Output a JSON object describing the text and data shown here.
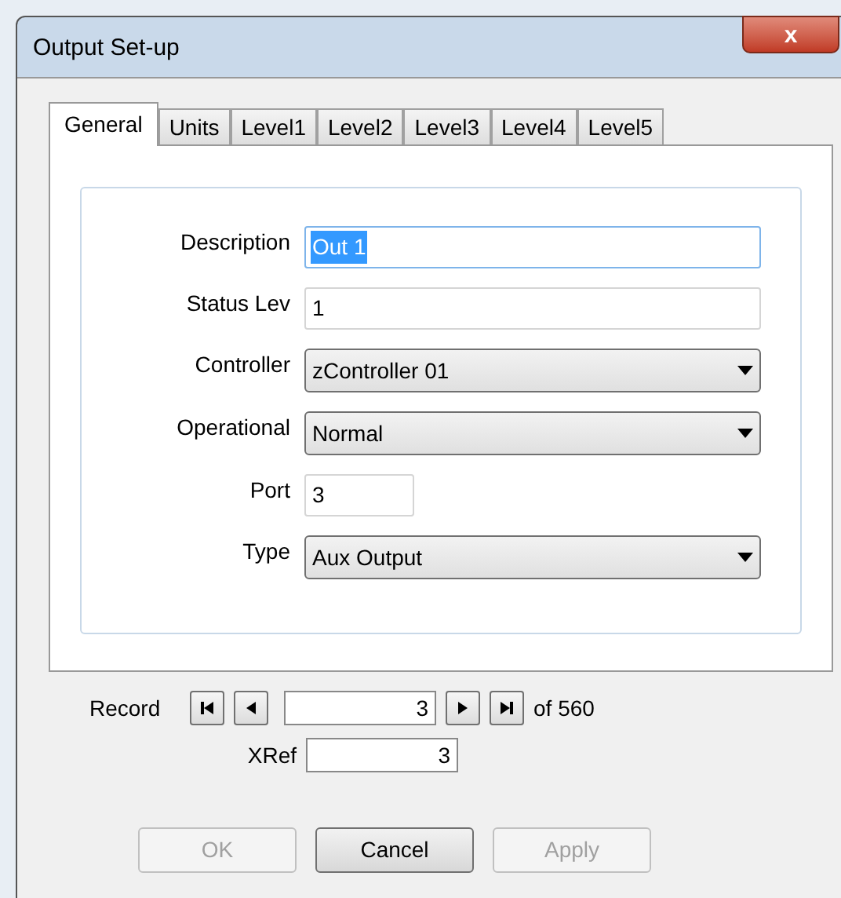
{
  "window": {
    "title": "Output Set-up",
    "close": "x"
  },
  "tabs": [
    {
      "label": "General",
      "selected": true
    },
    {
      "label": "Units",
      "selected": false
    },
    {
      "label": "Level1",
      "selected": false
    },
    {
      "label": "Level2",
      "selected": false
    },
    {
      "label": "Level3",
      "selected": false
    },
    {
      "label": "Level4",
      "selected": false
    },
    {
      "label": "Level5",
      "selected": false
    }
  ],
  "fields": [
    {
      "label": "Description",
      "kind": "text",
      "value": "Out 1",
      "focused": true
    },
    {
      "label": "Status Lev",
      "kind": "text",
      "value": "1",
      "focused": false
    },
    {
      "label": "Controller",
      "kind": "dropdown",
      "value": "zController 01",
      "focused": false
    },
    {
      "label": "Operational",
      "kind": "dropdown",
      "value": "Normal",
      "focused": false
    },
    {
      "label": "Port",
      "kind": "short",
      "value": "3",
      "focused": false
    },
    {
      "label": "Type",
      "kind": "dropdown",
      "value": "Aux Output",
      "focused": false
    }
  ],
  "record": {
    "label": "Record",
    "value": "3",
    "of": "of 560",
    "xref_label": "XRef",
    "xref_value": "3"
  },
  "buttons": [
    {
      "label": "OK",
      "disabled": true
    },
    {
      "label": "Cancel",
      "disabled": false
    },
    {
      "label": "Apply",
      "disabled": true
    }
  ]
}
